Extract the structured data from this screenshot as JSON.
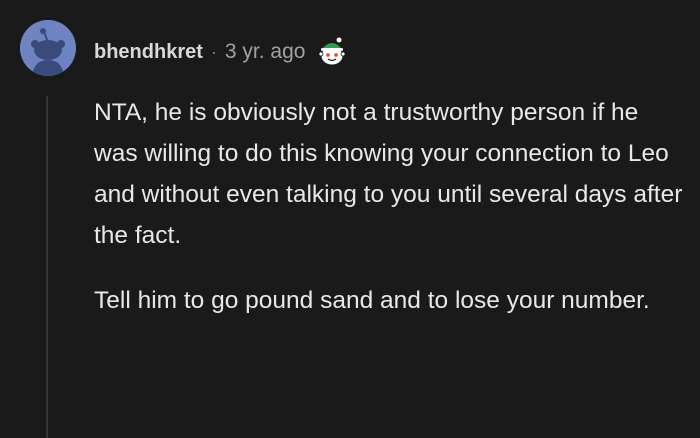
{
  "comment": {
    "username": "bhendhkret",
    "separator": "·",
    "age": "3 yr. ago",
    "award_icon": "festive-snoo-award-icon",
    "avatar_icon": "default-snoo-avatar-icon",
    "paragraphs": [
      "NTA, he is obviously not a trustworthy person if he was willing to do this knowing your connection to Leo and without even talking to you until several days after the fact.",
      "Tell him to go pound sand and to lose your number."
    ]
  },
  "colors": {
    "background": "#1a1a1b",
    "text": "#e8e8e8",
    "muted": "#a0a2a4",
    "thread_line": "#343536",
    "avatar_bg": "#6e84c2"
  }
}
